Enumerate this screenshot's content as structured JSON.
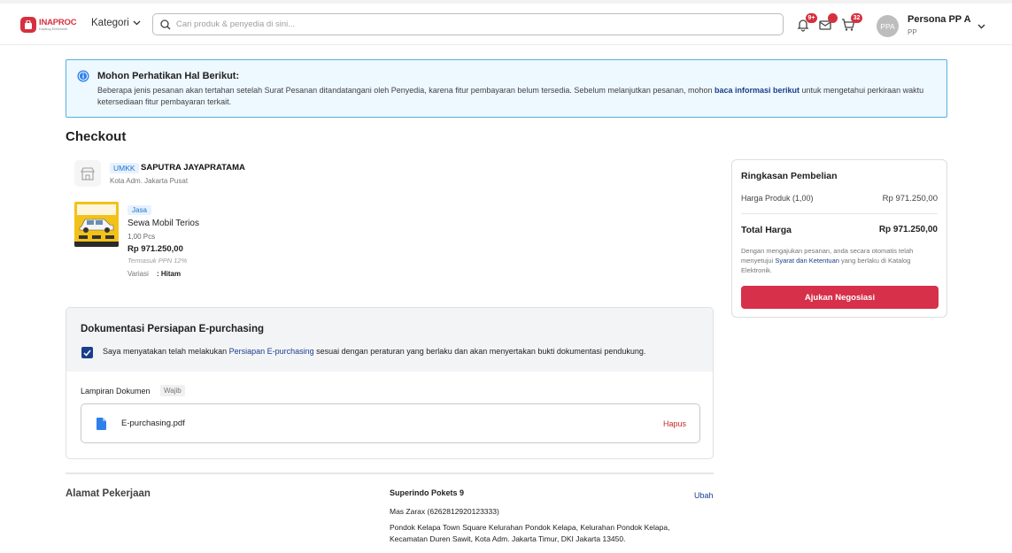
{
  "header": {
    "logo_main": "INAPROC",
    "logo_sub": "Katalog Elektronik",
    "kategori_label": "Kategori",
    "search_placeholder": "Cari produk & penyedia di sini...",
    "notif_badge": "9+",
    "cart_badge": "32",
    "avatar_initials": "PPA",
    "user_name": "Persona PP A",
    "user_role": "PP"
  },
  "notice": {
    "title": "Mohon Perhatikan Hal Berikut:",
    "body_before": "Beberapa jenis pesanan akan tertahan setelah Surat Pesanan ditandatangani oleh Penyedia, karena fitur pembayaran belum tersedia. Sebelum melanjutkan pesanan, mohon ",
    "body_link": "baca informasi berikut",
    "body_after": " untuk mengetahui perkiraan waktu ketersediaan fitur pembayaran terkait."
  },
  "page_title": "Checkout",
  "store": {
    "tag": "UMKK",
    "name": "SAPUTRA JAYAPRATAMA",
    "location": "Kota Adm. Jakarta Pusat"
  },
  "product": {
    "tag": "Jasa",
    "name": "Sewa Mobil Terios",
    "qty": "1,00 Pcs",
    "price": "Rp 971.250,00",
    "ppn": "Termasuk PPN 12%",
    "variant_label": "Variasi",
    "variant_value": ": Hitam"
  },
  "documentation": {
    "title": "Dokumentasi Persiapan E-purchasing",
    "checked": true,
    "statement_before": "Saya menyatakan telah melakukan ",
    "statement_link": "Persiapan E-purchasing",
    "statement_after": " sesuai dengan peraturan yang berlaku dan akan menyertakan bukti dokumentasi pendukung.",
    "attachment_label": "Lampiran Dokumen",
    "required_badge": "Wajib",
    "file_name": "E-purchasing.pdf",
    "delete_label": "Hapus"
  },
  "address": {
    "section_title": "Alamat Pekerjaan",
    "name": "Superindo Pokets 9",
    "change_label": "Ubah",
    "contact": "Mas Zarax (6262812920123333)",
    "line": "Pondok Kelapa Town Square Kelurahan Pondok Kelapa, Kelurahan Pondok Kelapa, Kecamatan Duren Sawit, Kota Adm. Jakarta Timur, DKI Jakarta 13450."
  },
  "summary": {
    "title": "Ringkasan Pembelian",
    "product_price_label": "Harga Produk (1,00)",
    "product_price_value": "Rp 971.250,00",
    "total_label": "Total Harga",
    "total_value": "Rp 971.250,00",
    "terms_before": "Dengan mengajukan pesanan, anda secara otomatis telah menyetujui ",
    "terms_link": "Syarat dan Ketentuan",
    "terms_after": " yang berlaku di Katalog Elektronik.",
    "button_label": "Ajukan Negosiasi"
  },
  "colors": {
    "brand_red": "#d6303f",
    "primary_blue": "#1a3e8c",
    "notice_border": "#55b0dc"
  }
}
